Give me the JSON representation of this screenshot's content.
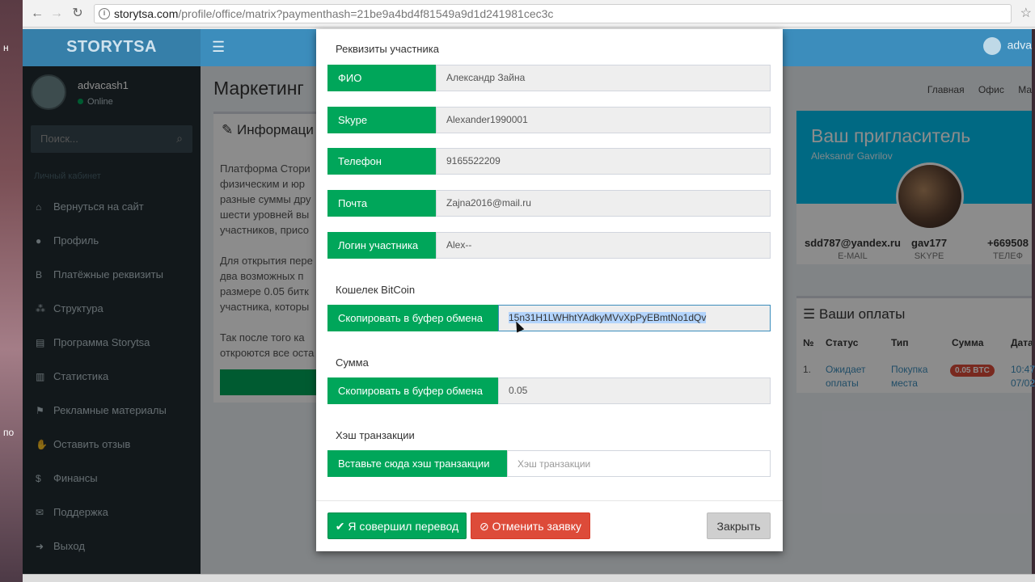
{
  "browser": {
    "url_host": "storytsa.com",
    "url_path": "/profile/office/matrix?paymenthash=21be9a4bd4f81549a9d1d241981cec3c"
  },
  "desktop": {
    "frag1": "н",
    "frag2": "по"
  },
  "app": {
    "logo": "STORYTSA",
    "top_user": "adva"
  },
  "sidebar": {
    "user_name": "advacash1",
    "user_status": "Online",
    "search_placeholder": "Поиск...",
    "section_header": "Личный кабинет",
    "items": [
      {
        "label": "Вернуться на сайт",
        "icon": "⌂"
      },
      {
        "label": "Профиль",
        "icon": "●"
      },
      {
        "label": "Платёжные реквизиты",
        "icon": "B"
      },
      {
        "label": "Структура",
        "icon": "⁂"
      },
      {
        "label": "Программа Storytsa",
        "icon": "▤"
      },
      {
        "label": "Статистика",
        "icon": "▥"
      },
      {
        "label": "Рекламные материалы",
        "icon": "⚑"
      },
      {
        "label": "Оставить отзыв",
        "icon": "✋"
      },
      {
        "label": "Финансы",
        "icon": "$"
      },
      {
        "label": "Поддержка",
        "icon": "✉"
      },
      {
        "label": "Выход",
        "icon": "➜"
      }
    ]
  },
  "main": {
    "title": "Маркетинг",
    "breadcrumbs": [
      "Главная",
      "Офис",
      "Ма"
    ],
    "info_title": "Информаци",
    "info_lines": [
      "Платформа Стори",
      "физическим и юр",
      "разные суммы дру",
      "шести уровней вы",
      "участников, присо",
      "",
      "Для открытия пере",
      "два возможных п",
      "размере 0.05 битк",
      "участника, которы",
      "",
      "Так после того ка",
      "откроются все оста"
    ]
  },
  "inviter": {
    "title": "Ваш пригласитель",
    "name": "Aleksandr Gavrilov",
    "email_value": "sdd787@yandex.ru",
    "email_label": "E-MAIL",
    "skype_value": "gav177",
    "skype_label": "SKYPE",
    "phone_value": "+669508",
    "phone_label": "ТЕЛЕФ"
  },
  "payments": {
    "title": "Ваши оплаты",
    "headers": [
      "№",
      "Статус",
      "Тип",
      "Сумма",
      "Дата"
    ],
    "row": {
      "num": "1.",
      "status_l1": "Ожидает",
      "status_l2": "оплаты",
      "type_l1": "Покупка",
      "type_l2": "места",
      "amount": "0.05 BTC",
      "date_l1": "10:47",
      "date_l2": "07/02"
    }
  },
  "modal": {
    "section_member": "Реквизиты участника",
    "fields": [
      {
        "label": "ФИО",
        "value": "Александр Зайна"
      },
      {
        "label": "Skype",
        "value": "Alexander1990001"
      },
      {
        "label": "Телефон",
        "value": "9165522209"
      },
      {
        "label": "Почта",
        "value": "Zajna2016@mail.ru"
      },
      {
        "label": "Логин участника",
        "value": "Alex--"
      }
    ],
    "section_wallet": "Кошелек BitCoin",
    "copy_label": "Скопировать в буфер обмена",
    "wallet_value": "15n31H1LWHhtYAdkyMVvXpPyEBmtNo1dQv",
    "section_amount": "Сумма",
    "amount_value": "0.05",
    "section_hash": "Хэш транзакции",
    "hash_button": "Вставьте сюда хэш транзакции",
    "hash_placeholder": "Хэш транзакции",
    "btn_done": "Я совершил перевод",
    "btn_cancel": "Отменить заявку",
    "btn_close": "Закрыть"
  }
}
